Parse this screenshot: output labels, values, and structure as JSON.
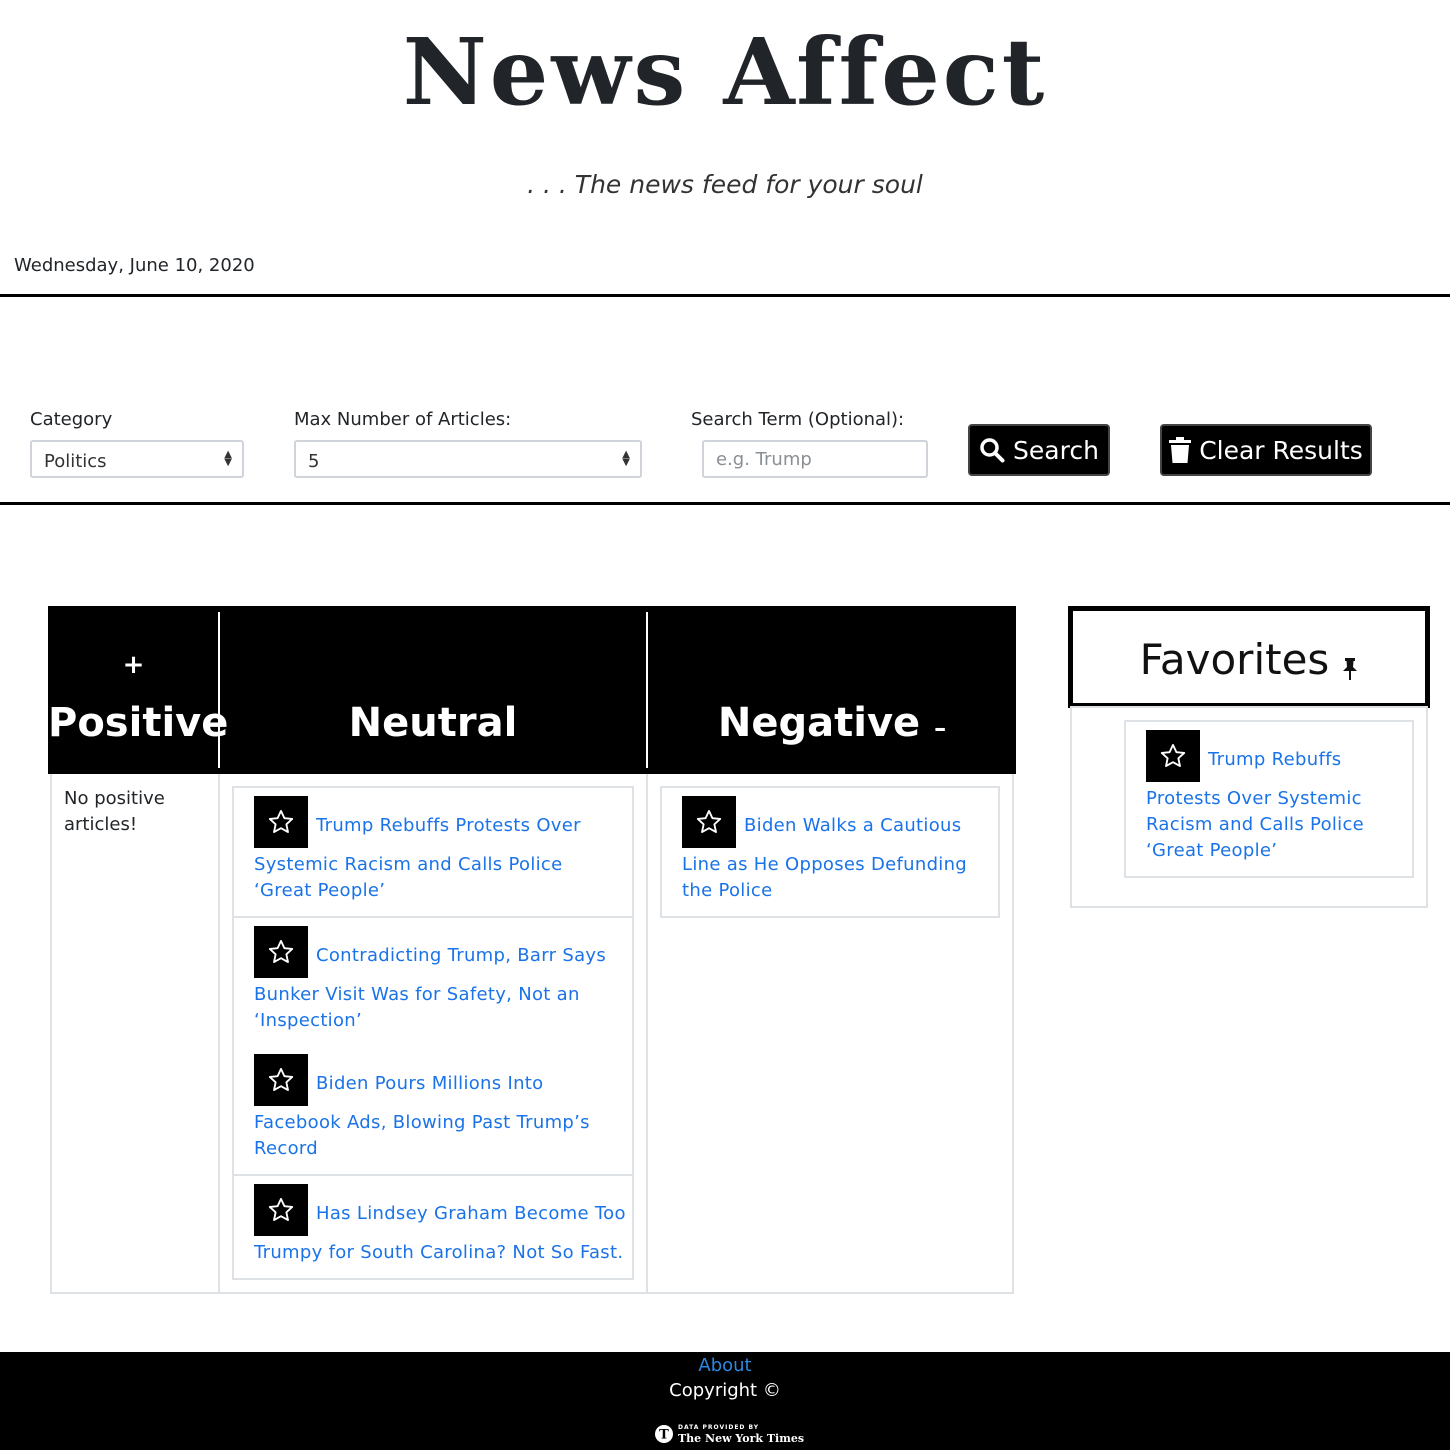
{
  "header": {
    "title": "News Affect",
    "tagline": ". . . The news feed for your soul",
    "date": "Wednesday, June 10, 2020"
  },
  "filters": {
    "category_label": "Category",
    "category_value": "Politics",
    "max_label": "Max Number of Articles:",
    "max_value": "5",
    "search_label": "Search Term (Optional):",
    "search_placeholder": "e.g. Trump",
    "search_button": "Search",
    "clear_button": "Clear Results"
  },
  "table": {
    "positive_symbol": "+",
    "positive_label": "Positive",
    "neutral_label": "Neutral",
    "negative_label": "Negative",
    "negative_symbol": "–",
    "positive_empty": "No positive articles!",
    "neutral_articles": [
      {
        "first": "Trump Rebuffs Protests Over",
        "rest": "Systemic Racism and Calls Police ‘Great People’"
      },
      {
        "first": "Contradicting Trump, Barr Says",
        "rest": "Bunker Visit Was for Safety, Not an ‘Inspection’"
      },
      {
        "first": "Biden Pours Millions Into",
        "rest": "Facebook Ads, Blowing Past Trump’s Record"
      },
      {
        "first": "Has Lindsey Graham Become Too",
        "rest": "Trumpy for South Carolina? Not So Fast."
      }
    ],
    "negative_articles": [
      {
        "first": "Biden Walks a Cautious",
        "rest": "Line as He Opposes Defunding the Police"
      }
    ]
  },
  "favorites": {
    "title": "Favorites",
    "pin_icon": "pushpin-icon",
    "articles": [
      {
        "first": "Trump Rebuffs",
        "rest": "Protests Over Systemic Racism and Calls Police ‘Great People’"
      }
    ]
  },
  "footer": {
    "about": "About",
    "copyright": "Copyright ©",
    "credit_small": "DATA PROVIDED BY",
    "credit_big": "The New York Times"
  },
  "colors": {
    "link": "#1a73e8",
    "black": "#000000",
    "border": "#dee2e6"
  }
}
